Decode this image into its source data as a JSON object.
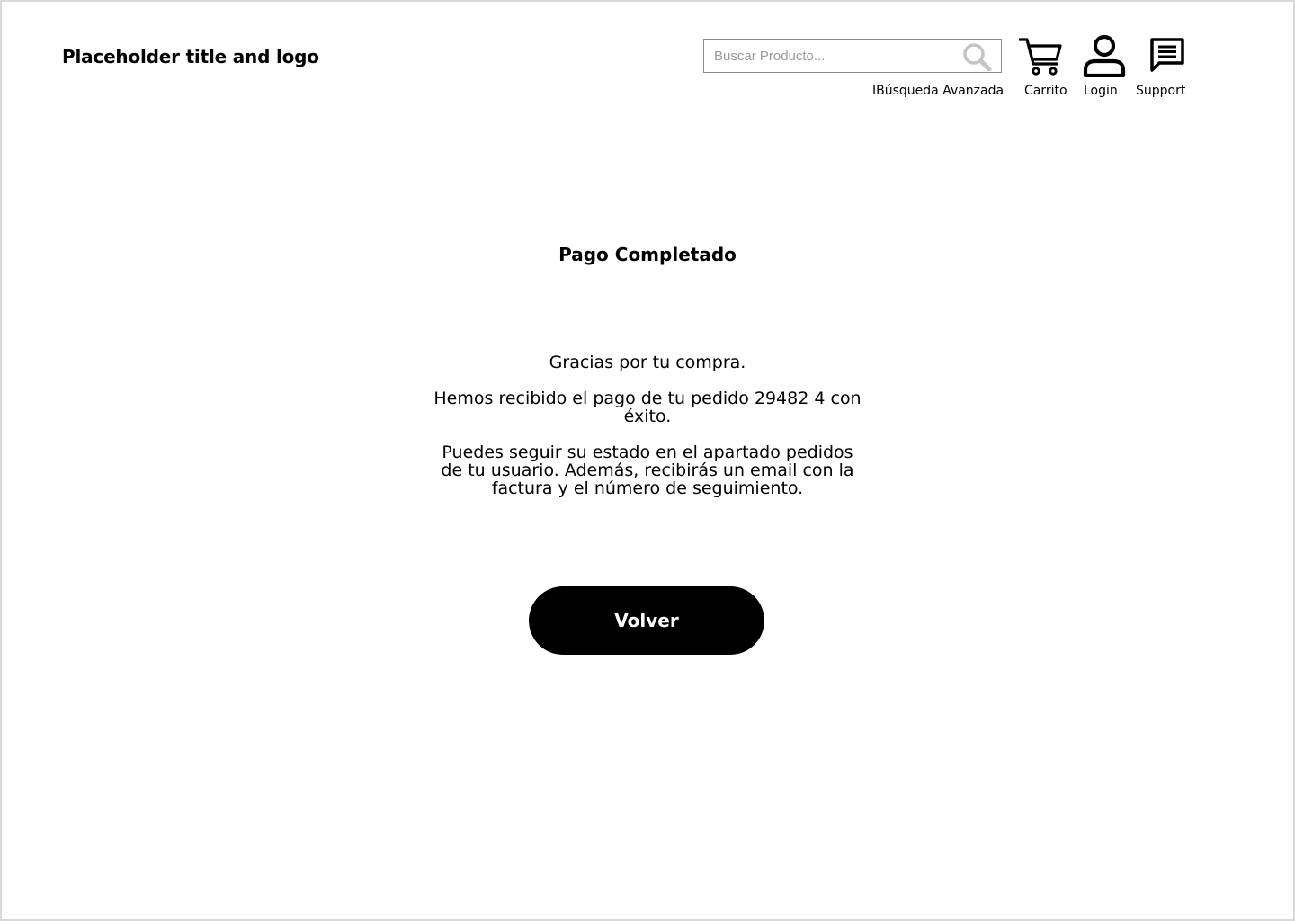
{
  "header": {
    "logo_text": "Placeholder title and logo",
    "search": {
      "placeholder": "Buscar Producto..."
    },
    "nav": {
      "advanced_search_label": "IBúsqueda Avanzada",
      "cart_label": "Carrito",
      "login_label": "Login",
      "support_label": "Support"
    },
    "icons": {
      "search": "search-icon",
      "cart": "cart-icon",
      "user": "user-icon",
      "support": "chat-icon"
    }
  },
  "main": {
    "title": "Pago Completado",
    "line1": "Gracias por tu compra.",
    "line2": "Hemos recibido el pago de tu pedido 29482 4 con éxito.",
    "line3": "Puedes seguir su estado en el apartado pedidos de tu usuario. Además, recibirás un email con la factura y el número de seguimiento.",
    "button_label": "Volver"
  },
  "colors": {
    "button_bg": "#000000",
    "button_text": "#ffffff",
    "search_icon": "#c4c4c4"
  }
}
